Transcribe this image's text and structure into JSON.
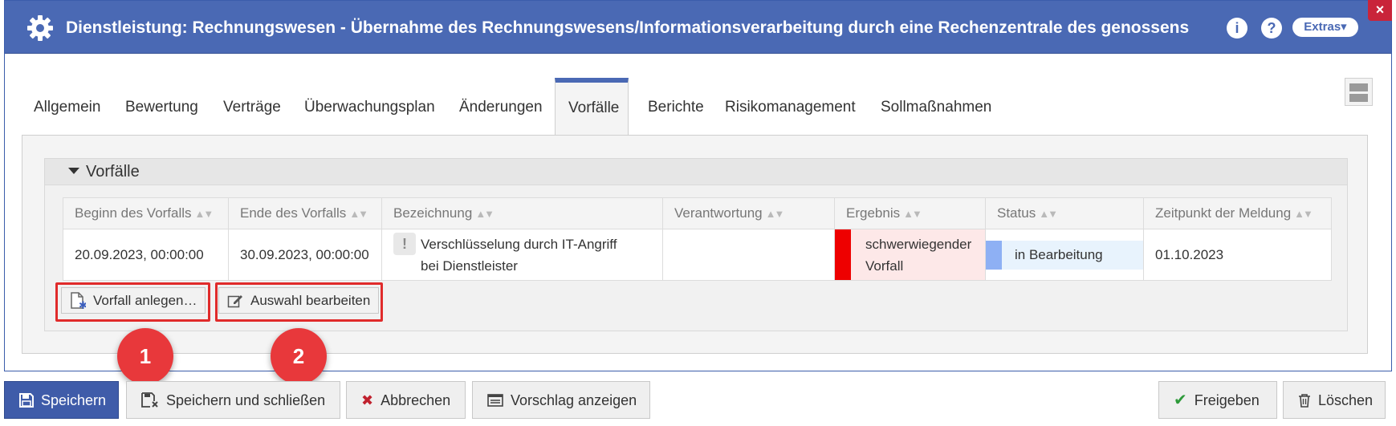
{
  "window": {
    "title": "Dienstleistung: Rechnungswesen - Übernahme des Rechnungswesens/Informationsverarbeitung durch eine Rechenzentrale des genossenscha…",
    "info_label": "i",
    "help_label": "?",
    "extras_label": "Extras▾",
    "close_label": "×",
    "accent_color": "#4a69b4"
  },
  "tabs": [
    {
      "label": "Allgemein"
    },
    {
      "label": "Bewertung"
    },
    {
      "label": "Verträge"
    },
    {
      "label": "Überwachungsplan"
    },
    {
      "label": "Änderungen"
    },
    {
      "label": "Vorfälle",
      "active": true
    },
    {
      "label": "Berichte"
    },
    {
      "label": "Risikomanagement"
    },
    {
      "label": "Sollmaßnahmen"
    }
  ],
  "section": {
    "title": "Vorfälle"
  },
  "table": {
    "columns": [
      "Beginn des Vorfalls",
      "Ende des Vorfalls",
      "Bezeichnung",
      "Verantwortung",
      "Ergebnis",
      "Status",
      "Zeitpunkt der Meldung"
    ],
    "rows": [
      {
        "beginn": "20.09.2023, 00:00:00",
        "ende": "30.09.2023, 00:00:00",
        "bezeichnung_line1": "Verschlüsselung durch IT-Angriff",
        "bezeichnung_line2": "bei Dienstleister",
        "verantwortung": "",
        "ergebnis_line1": "schwerwiegender",
        "ergebnis_line2": "Vorfall",
        "ergebnis_color": "#ee0000",
        "status": "in Bearbeitung",
        "status_color": "#8eb0f4",
        "meldung": "01.10.2023"
      }
    ]
  },
  "section_buttons": {
    "create": "Vorfall anlegen…",
    "edit": "Auswahl bearbeiten"
  },
  "annotations": {
    "badge1": "1",
    "badge2": "2"
  },
  "footer": {
    "save": "Speichern",
    "save_close": "Speichern und schließen",
    "cancel": "Abbrechen",
    "suggestion": "Vorschlag anzeigen",
    "release": "Freigeben",
    "delete": "Löschen"
  }
}
